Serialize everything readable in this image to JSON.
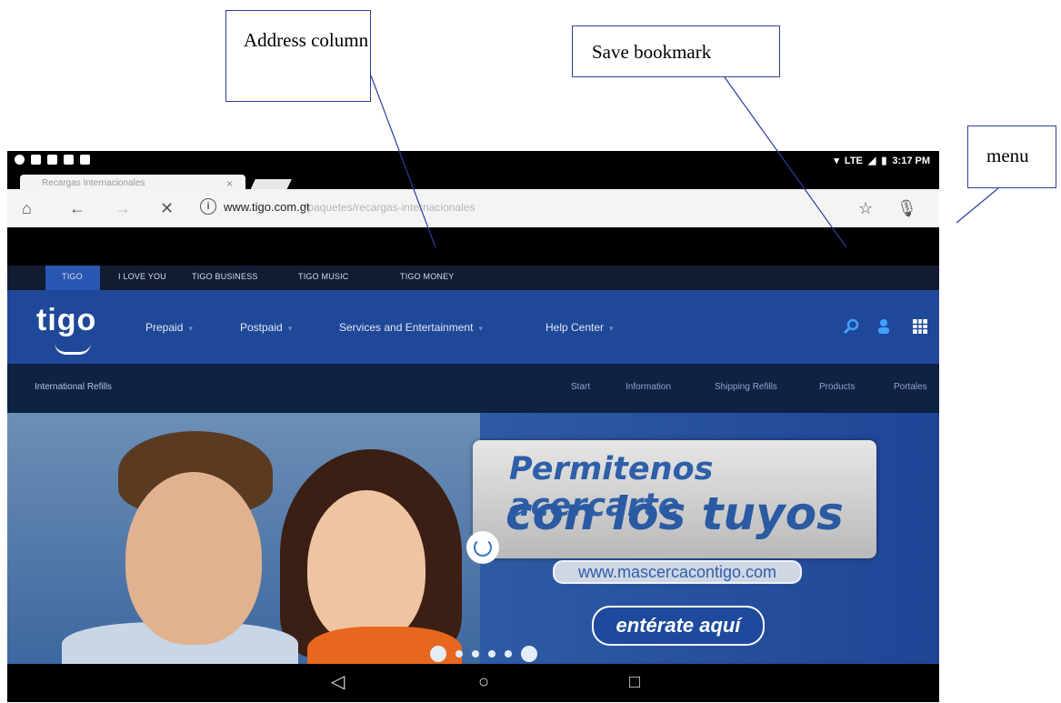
{
  "callouts": {
    "address": "Address column",
    "bookmark": "Save bookmark",
    "menu": "menu"
  },
  "status_bar": {
    "network": "LTE",
    "time": "3:17 PM"
  },
  "tab": {
    "title": "Recargas Internacionales",
    "close": "×"
  },
  "toolbar": {
    "url_host": "www.tigo.com.gt",
    "url_path": "/paquetes/recargas-internacionales"
  },
  "top_nav": [
    "TIGO",
    "I LOVE YOU",
    "TIGO BUSINESS",
    "TIGO MUSIC",
    "TIGO MONEY"
  ],
  "logo": "tigo",
  "main_nav": [
    "Prepaid",
    "Postpaid",
    "Services and Entertainment",
    "Help Center"
  ],
  "sub_nav": {
    "title": "International Refills",
    "links": [
      "Start",
      "Information",
      "Shipping Refills",
      "Products",
      "Portales"
    ]
  },
  "hero": {
    "line1": "Permitenos acercarte",
    "line2": "con los tuyos",
    "url": "www.mascercacontigo.com",
    "cta": "entérate aquí"
  },
  "colors": {
    "brand_blue": "#1f4898",
    "dark_navy": "#0e2244",
    "callout_border": "#2c3e9a"
  }
}
